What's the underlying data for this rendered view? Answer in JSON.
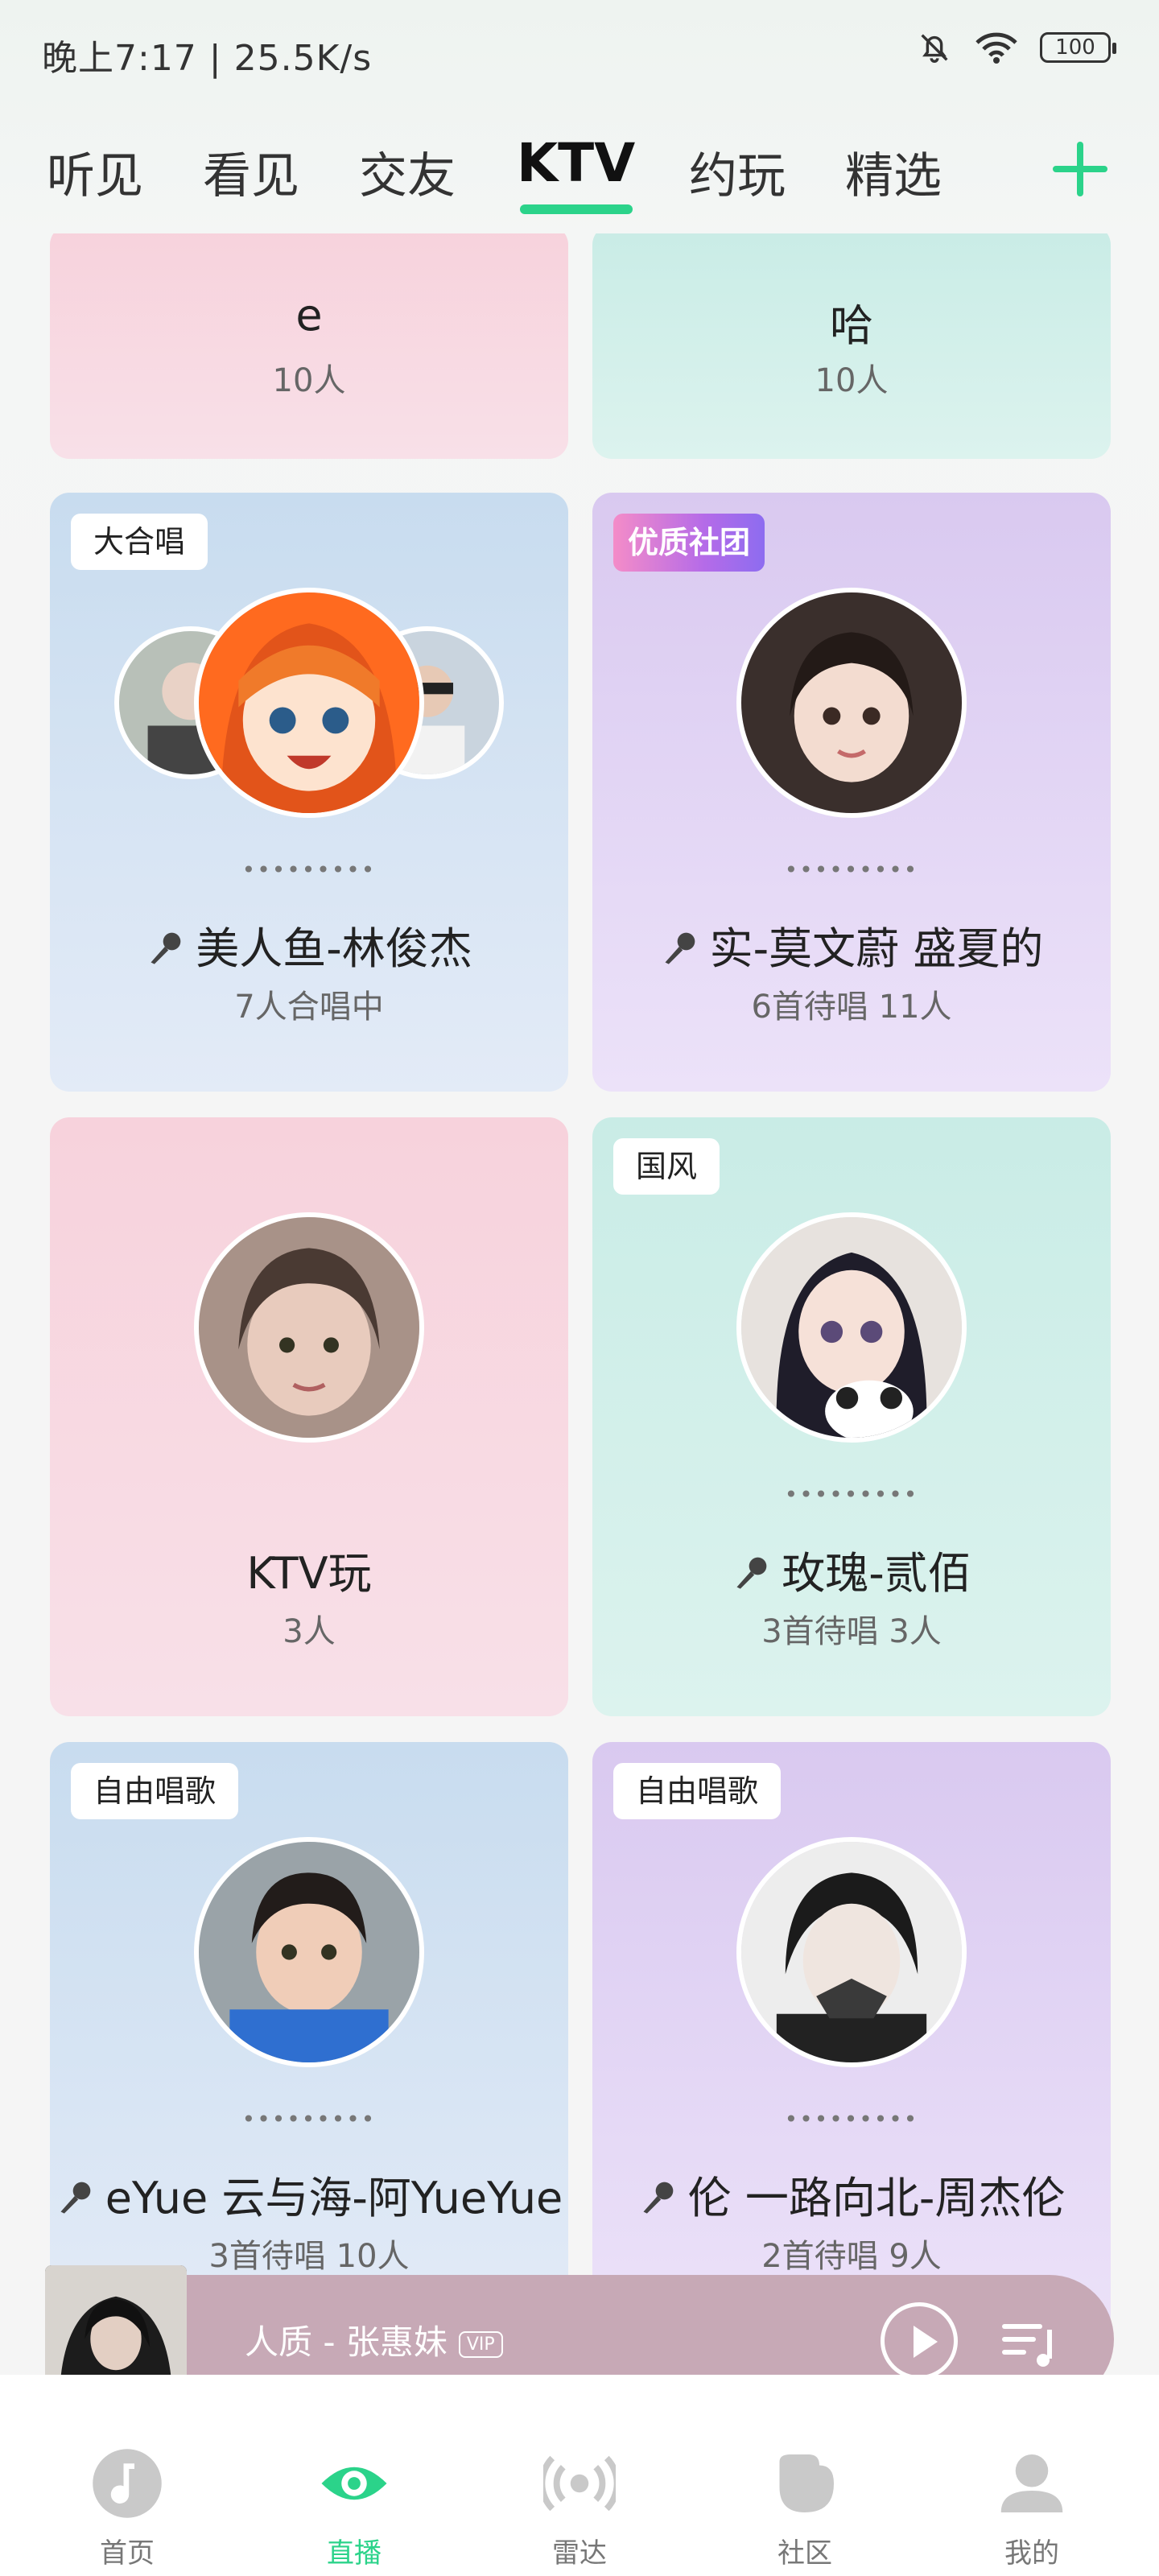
{
  "status": {
    "time": "晚上7:17 | 25.5K/s",
    "battery": "100"
  },
  "tabs": [
    {
      "label": "听见"
    },
    {
      "label": "看见"
    },
    {
      "label": "交友"
    },
    {
      "label": "KTV"
    },
    {
      "label": "约玩"
    },
    {
      "label": "精选"
    }
  ],
  "active_tab": "KTV",
  "accent_color": "#2bd38a",
  "cards": [
    {
      "title": "e",
      "sub": "10人"
    },
    {
      "title": "哈",
      "sub": "10人"
    },
    {
      "tag": "大合唱",
      "dots": "•••••••••",
      "title": "美人鱼-林俊杰",
      "sub": "7人合唱中"
    },
    {
      "tag": "优质社团",
      "dots": "•••••••••",
      "title": "实-莫文蔚  盛夏的",
      "sub": "6首待唱  11人"
    },
    {
      "title": "KTV玩",
      "sub": "3人"
    },
    {
      "tag": "国风",
      "dots": "•••••••••",
      "title": "玫瑰-贰佰",
      "sub": "3首待唱  3人"
    },
    {
      "tag": "自由唱歌",
      "dots": "•••••••••",
      "title": "eYue  云与海-阿YueYue",
      "sub": "3首待唱  10人"
    },
    {
      "tag": "自由唱歌",
      "dots": "•••••••••",
      "title": "伦  一路向北-周杰伦",
      "sub": "2首待唱  9人"
    }
  ],
  "player": {
    "song": "人质 - 张惠妹",
    "badge": "VIP"
  },
  "bottom_nav": [
    {
      "label": "首页",
      "icon": "music-note-icon"
    },
    {
      "label": "直播",
      "icon": "eye-icon"
    },
    {
      "label": "雷达",
      "icon": "radar-icon"
    },
    {
      "label": "社区",
      "icon": "community-icon"
    },
    {
      "label": "我的",
      "icon": "profile-icon"
    }
  ]
}
